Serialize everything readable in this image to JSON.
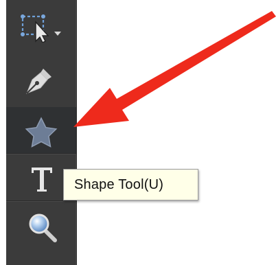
{
  "toolbar": {
    "tools": [
      {
        "name": "selection-tool",
        "icon": "selection-arrow-icon"
      },
      {
        "name": "pen-tool",
        "icon": "pen-icon"
      },
      {
        "name": "shape-tool",
        "icon": "star-icon",
        "active": true
      },
      {
        "name": "text-tool",
        "icon": "text-icon"
      },
      {
        "name": "zoom-tool",
        "icon": "zoom-icon"
      }
    ]
  },
  "tooltip": {
    "text": "Shape Tool(U)"
  },
  "annotation": {
    "arrow_color": "#ee2a1c"
  },
  "colors": {
    "toolbar_bg": "#3b3b3b",
    "active_tool_bg": "#2f3133",
    "tooltip_bg": "#ffffe8"
  }
}
